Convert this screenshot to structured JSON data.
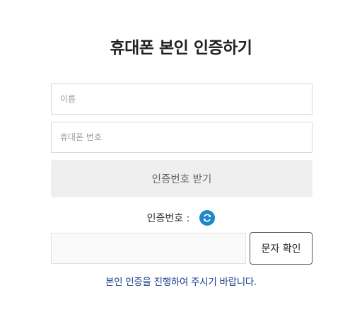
{
  "page": {
    "title": "휴대폰 본인 인증하기"
  },
  "form": {
    "name_placeholder": "이름",
    "name_value": "",
    "phone_placeholder": "휴대폰 번호",
    "phone_value": "",
    "request_code_label": "인증번호 받기",
    "code_label": "인증번호 :",
    "code_value": "",
    "confirm_label": "문자 확인"
  },
  "notice": {
    "text": "본인 인증을 진행하여 주시기 바랍니다."
  },
  "icons": {
    "refresh": "refresh-icon"
  },
  "colors": {
    "notice_text": "#1d3f8f",
    "refresh_icon_bg": "#1e88c9",
    "request_button_bg": "#efefef"
  }
}
